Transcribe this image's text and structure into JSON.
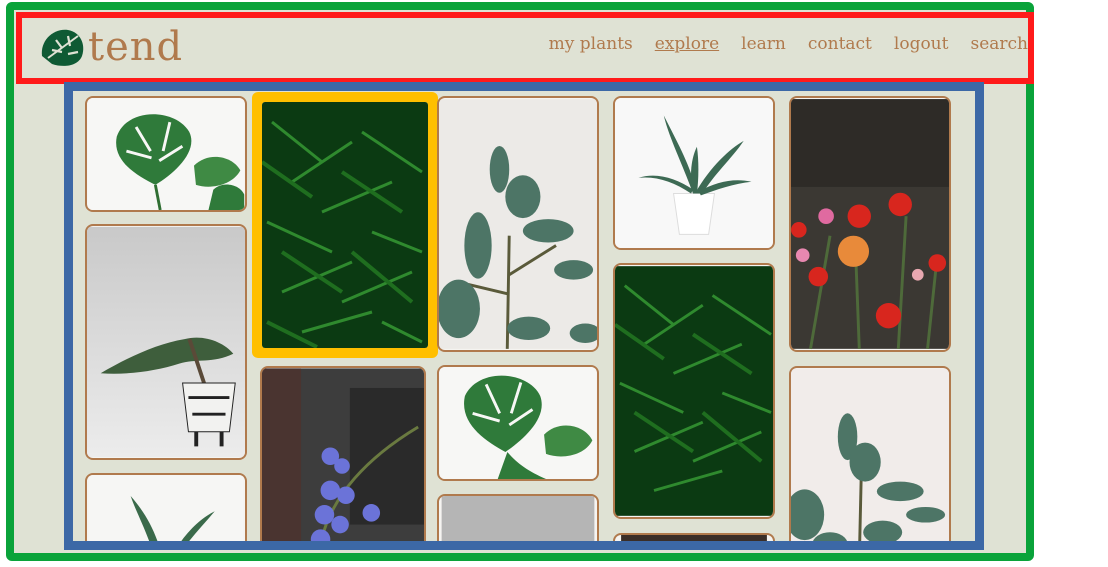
{
  "brand": {
    "name": "tend",
    "logo_icon": "monstera-leaf-icon"
  },
  "nav": {
    "items": [
      "my plants",
      "explore",
      "learn",
      "contact",
      "logout",
      "search"
    ],
    "active": "explore"
  },
  "colors": {
    "outer_frame": "#0aa33a",
    "header_outline": "#ff1a1a",
    "gallery_outline": "#3c68a6",
    "selected_highlight": "#ffbf00",
    "page_bg": "#dfe2d4",
    "brand_text": "#b07a4d"
  },
  "gallery": {
    "images": [
      "monstera-photo",
      "fern-photo",
      "rubber-plant-photo",
      "succulent-photo",
      "dahlia-flowers-photo",
      "bonsai-photo",
      "orchid-photo",
      "monstera-photo-2",
      "fern-photo-2",
      "rubber-plant-photo-2",
      "succulent-photo-2",
      "plant-photo"
    ]
  }
}
